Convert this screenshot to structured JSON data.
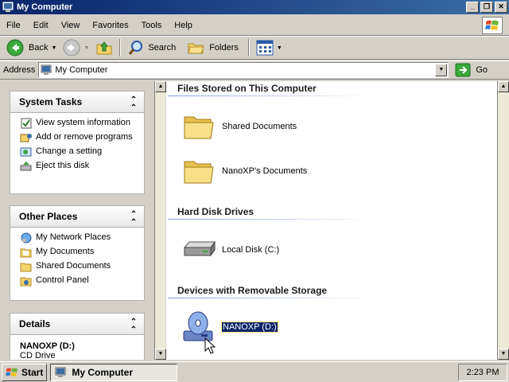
{
  "window": {
    "title": "My Computer"
  },
  "menu": [
    "File",
    "Edit",
    "View",
    "Favorites",
    "Tools",
    "Help"
  ],
  "toolbar": {
    "back": "Back",
    "search": "Search",
    "folders": "Folders"
  },
  "address": {
    "label": "Address",
    "value": "My Computer",
    "go": "Go"
  },
  "system_tasks": {
    "title": "System Tasks",
    "items": [
      "View system information",
      "Add or remove programs",
      "Change a setting",
      "Eject this disk"
    ]
  },
  "other_places": {
    "title": "Other Places",
    "items": [
      "My Network Places",
      "My Documents",
      "Shared Documents",
      "Control Panel"
    ]
  },
  "details": {
    "title": "Details",
    "name": "NANOXP (D:)",
    "type": "CD Drive"
  },
  "groups": {
    "files": {
      "title": "Files Stored on This Computer",
      "items": [
        "Shared Documents",
        "NanoXP's Documents"
      ]
    },
    "disks": {
      "title": "Hard Disk Drives",
      "items": [
        "Local Disk (C:)"
      ]
    },
    "removable": {
      "title": "Devices with Removable Storage",
      "items": [
        "NANOXP (D:)"
      ]
    }
  },
  "taskbar": {
    "start": "Start",
    "task": "My Computer",
    "clock": "2:23 PM"
  },
  "colors": {
    "titlebar": "#0a246a",
    "selection": "#0a246a",
    "face": "#d4d0c8"
  }
}
